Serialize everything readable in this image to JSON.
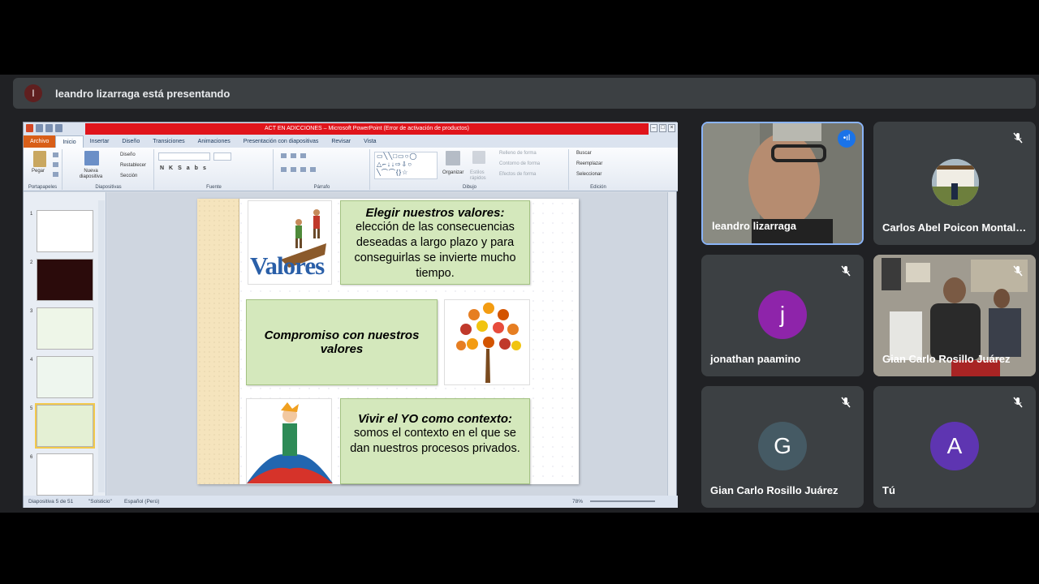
{
  "banner": {
    "avatar_letter": "l",
    "text": "leandro lizarraga está presentando"
  },
  "ppt": {
    "title": "ACT EN ADICCIONES  –  Microsoft PowerPoint (Error de activación de productos)",
    "tabs": [
      "Archivo",
      "Inicio",
      "Insertar",
      "Diseño",
      "Transiciones",
      "Animaciones",
      "Presentación con diapositivas",
      "Revisar",
      "Vista"
    ],
    "ribbon": {
      "paste": "Pegar",
      "clipboard": "Portapapeles",
      "new_slide": "Nueva diapositiva",
      "layout": "Diseño",
      "reset": "Restablecer",
      "section": "Sección",
      "slides": "Diapositivas",
      "font": "Fuente",
      "paragraph": "Párrafo",
      "arrange": "Organizar",
      "quick_styles": "Estilos rápidos",
      "fill": "Relleno de forma",
      "outline": "Contorno de forma",
      "effects": "Efectos de forma",
      "drawing": "Dibujo",
      "find": "Buscar",
      "replace": "Reemplazar",
      "select": "Seleccionar",
      "editing": "Edición"
    },
    "thumbnails": [
      "1",
      "2",
      "3",
      "4",
      "5",
      "6"
    ],
    "status": {
      "slide": "Diapositiva 5 de 51",
      "theme": "\"Solsticio\"",
      "lang": "Español (Perú)",
      "zoom": "78%"
    },
    "slide": {
      "card1_head": "Elegir nuestros valores:",
      "card1_body": "elección de las consecuencias deseadas a largo plazo y para conseguirlas se invierte mucho tiempo.",
      "valores_word": "Valores",
      "card2_head": "Compromiso con nuestros valores",
      "card3_head": "Vivir el YO como contexto:",
      "card3_body": "somos el contexto en el que se dan nuestros procesos privados."
    }
  },
  "participants": [
    {
      "name": "leandro lizarraga",
      "speaking": true
    },
    {
      "name": "Carlos Abel Poicon Montal…",
      "muted": true
    },
    {
      "name": "jonathan paamino",
      "letter": "j",
      "color": "#8e24aa",
      "muted": true
    },
    {
      "name": "Gian Carlo Rosillo Juárez",
      "muted": true
    },
    {
      "name": "Gian Carlo Rosillo Juárez",
      "letter": "G",
      "color": "#455a64",
      "muted": true
    },
    {
      "name": "Tú",
      "letter": "A",
      "color": "#5e35b1",
      "muted": true
    }
  ]
}
